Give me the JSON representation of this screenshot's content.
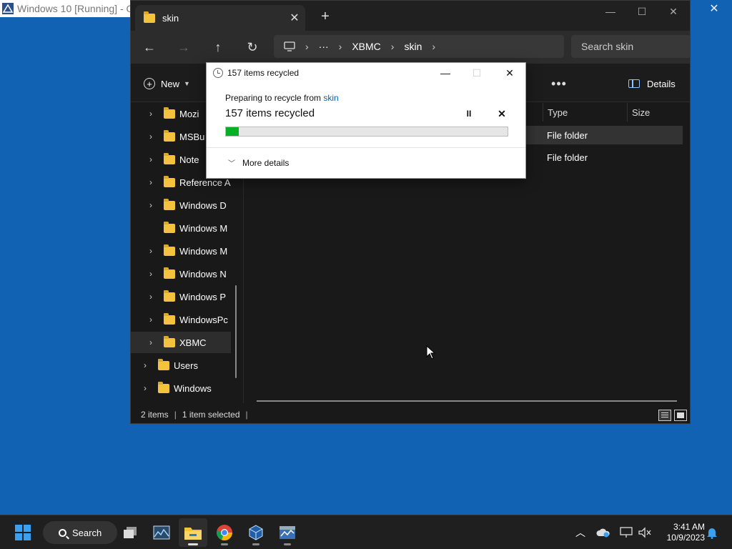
{
  "host": {
    "title": "Windows 10 [Running] - Oracle VM VirtualBox",
    "visible_title": "Windows 10 [Running] - Orac"
  },
  "explorer": {
    "tab_title": "skin",
    "address": {
      "segments": [
        "XBMC",
        "skin"
      ],
      "overflow": "···"
    },
    "search_placeholder": "Search skin",
    "cmdbar": {
      "new_label": "New",
      "more": "•••",
      "details_label": "Details"
    },
    "tree": [
      {
        "label": "Mozi",
        "expandable": true,
        "selected": false
      },
      {
        "label": "MSBu",
        "expandable": true,
        "selected": false
      },
      {
        "label": "Note",
        "expandable": true,
        "selected": false
      },
      {
        "label": "Reference A",
        "expandable": true,
        "selected": false
      },
      {
        "label": "Windows D",
        "expandable": true,
        "selected": false
      },
      {
        "label": "Windows M",
        "expandable": false,
        "selected": false
      },
      {
        "label": "Windows M",
        "expandable": true,
        "selected": false
      },
      {
        "label": "Windows N",
        "expandable": true,
        "selected": false
      },
      {
        "label": "Windows P",
        "expandable": true,
        "selected": false
      },
      {
        "label": "WindowsPc",
        "expandable": true,
        "selected": false
      },
      {
        "label": "XBMC",
        "expandable": true,
        "selected": true
      },
      {
        "label": "Users",
        "expandable": true,
        "selected": false
      },
      {
        "label": "Windows",
        "expandable": true,
        "selected": false
      }
    ],
    "columns": [
      "Type",
      "Size"
    ],
    "rows": [
      {
        "type": "File folder",
        "selected": true
      },
      {
        "type": "File folder",
        "selected": false
      }
    ],
    "status": {
      "items": "2 items",
      "selection": "1 item selected",
      "trailing_sep": "|"
    }
  },
  "dialog": {
    "title": "157 items recycled",
    "from_prefix": "Preparing to recycle from ",
    "from_link": "skin",
    "status": "157 items recycled",
    "pause_symbol": "II",
    "cancel_symbol": "✕",
    "progress_fraction": 0.045,
    "progress_color": "#06b025",
    "more_details": "More details"
  },
  "taskbar": {
    "search_label": "Search",
    "apps": [
      "start-icon",
      "task-view-icon",
      "photos-icon",
      "file-explorer-icon",
      "chrome-icon",
      "virtualbox-icon",
      "task-manager-icon"
    ],
    "active_app": "file-explorer-icon",
    "time": "3:41 AM",
    "date": "10/9/2023"
  },
  "colors": {
    "desktop": "#1262b4",
    "accent": "#3aa0f2",
    "folder": "#f3c33e"
  }
}
